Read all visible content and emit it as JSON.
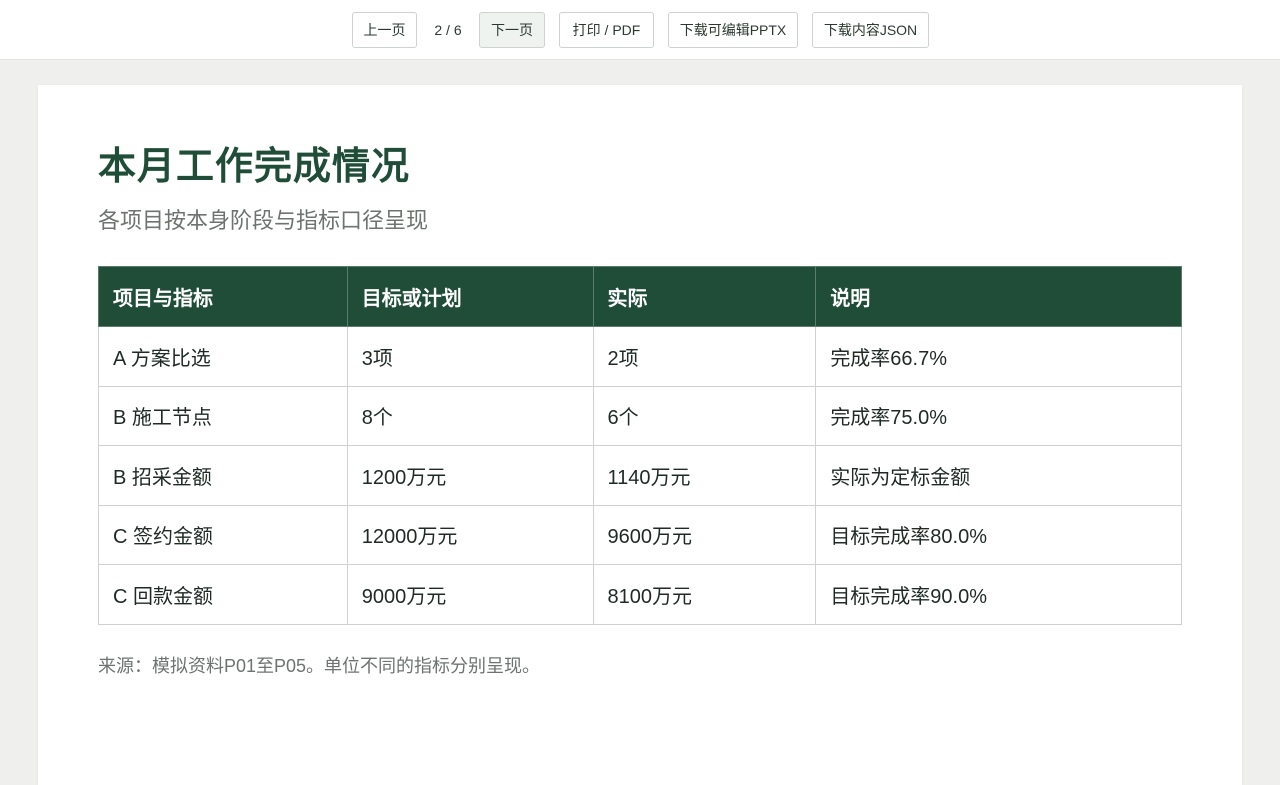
{
  "toolbar": {
    "prev_label": "上一页",
    "page_indicator": "2 / 6",
    "next_label": "下一页",
    "print_label": "打印 / PDF",
    "pptx_label": "下载可编辑PPTX",
    "json_label": "下载内容JSON"
  },
  "slide": {
    "title": "本月工作完成情况",
    "subtitle": "各项目按本身阶段与指标口径呈现",
    "table": {
      "headers": [
        "项目与指标",
        "目标或计划",
        "实际",
        "说明"
      ],
      "rows": [
        [
          "A 方案比选",
          "3项",
          "2项",
          "完成率66.7%"
        ],
        [
          "B 施工节点",
          "8个",
          "6个",
          "完成率75.0%"
        ],
        [
          "B 招采金额",
          "1200万元",
          "1140万元",
          "实际为定标金额"
        ],
        [
          "C 签约金额",
          "12000万元",
          "9600万元",
          "目标完成率80.0%"
        ],
        [
          "C 回款金额",
          "9000万元",
          "8100万元",
          "目标完成率90.0%"
        ]
      ]
    },
    "source": "来源：模拟资料P01至P05。单位不同的指标分别呈现。"
  },
  "colors": {
    "accent": "#1f4d38",
    "background": "#efefed"
  }
}
